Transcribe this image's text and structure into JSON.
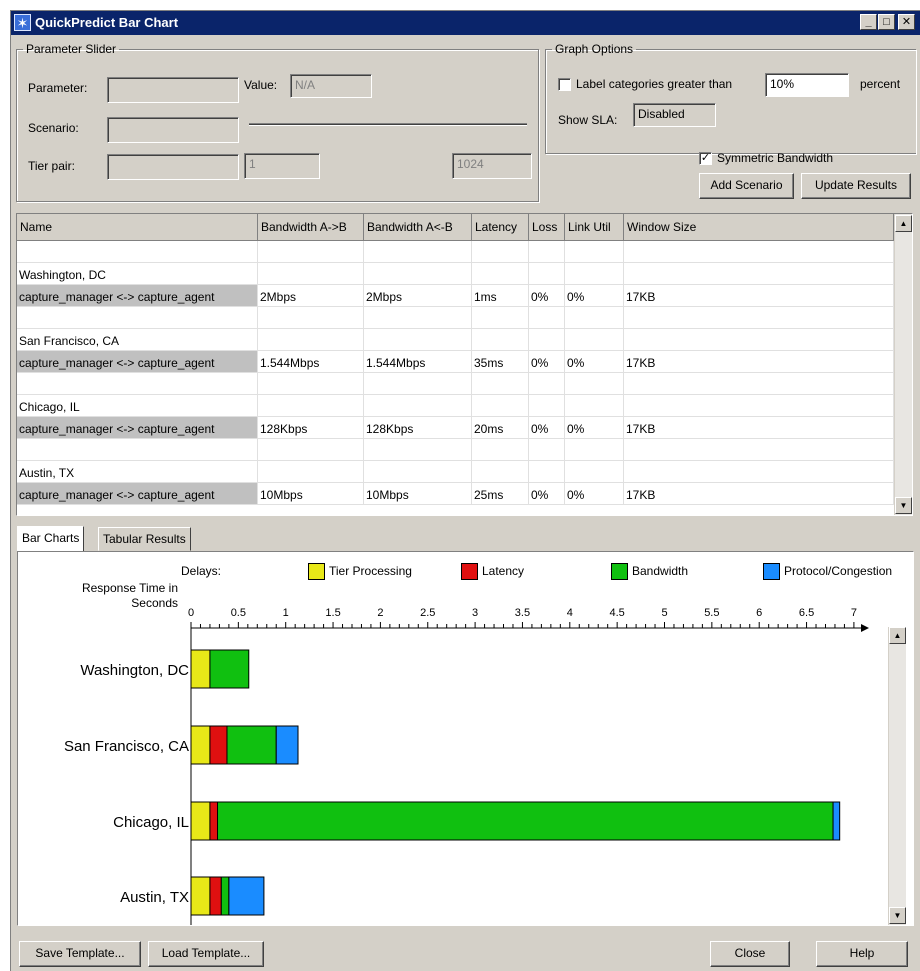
{
  "window": {
    "title": "QuickPredict Bar Chart"
  },
  "parameter_slider": {
    "legend": "Parameter Slider",
    "parameter_label": "Parameter:",
    "value_label": "Value:",
    "value": "N/A",
    "scenario_label": "Scenario:",
    "tier_pair_label": "Tier pair:",
    "min": "1",
    "max": "1024"
  },
  "graph_options": {
    "legend": "Graph Options",
    "label_categories_label": "Label categories greater than",
    "label_categories_value": "10%",
    "percent_label": "percent",
    "show_sla_label": "Show SLA:",
    "show_sla_value": "Disabled",
    "symmetric_bandwidth_label": "Symmetric Bandwidth",
    "symmetric_checked": true,
    "add_scenario": "Add Scenario",
    "update_results": "Update Results"
  },
  "table": {
    "columns": [
      "Name",
      "Bandwidth A->B",
      "Bandwidth A<-B",
      "Latency",
      "Loss",
      "Link Util",
      "Window Size"
    ],
    "groups": [
      {
        "location": "Washington, DC",
        "link": "capture_manager <-> capture_agent",
        "bw_ab": "2Mbps",
        "bw_ba": "2Mbps",
        "latency": "1ms",
        "loss": "0%",
        "util": "0%",
        "window": "17KB"
      },
      {
        "location": "San Francisco, CA",
        "link": "capture_manager <-> capture_agent",
        "bw_ab": "1.544Mbps",
        "bw_ba": "1.544Mbps",
        "latency": "35ms",
        "loss": "0%",
        "util": "0%",
        "window": "17KB"
      },
      {
        "location": "Chicago, IL",
        "link": "capture_manager <-> capture_agent",
        "bw_ab": "128Kbps",
        "bw_ba": "128Kbps",
        "latency": "20ms",
        "loss": "0%",
        "util": "0%",
        "window": "17KB"
      },
      {
        "location": "Austin, TX",
        "link": "capture_manager <-> capture_agent",
        "bw_ab": "10Mbps",
        "bw_ba": "10Mbps",
        "latency": "25ms",
        "loss": "0%",
        "util": "0%",
        "window": "17KB"
      }
    ]
  },
  "tabs": [
    "Bar Charts",
    "Tabular Results"
  ],
  "chart_data": {
    "type": "bar",
    "orientation": "horizontal",
    "stacked": true,
    "legend_title": "Delays:",
    "axis_label": "Response Time in Seconds",
    "xlim": [
      0,
      7
    ],
    "ticks": [
      "0",
      "0.5",
      "1",
      "1.5",
      "2",
      "2.5",
      "3",
      "3.5",
      "4",
      "4.5",
      "5",
      "5.5",
      "6",
      "6.5",
      "7"
    ],
    "categories": [
      "Washington, DC",
      "San Francisco, CA",
      "Chicago, IL",
      "Austin, TX"
    ],
    "series": [
      {
        "name": "Tier Processing",
        "color": "#e8e818",
        "values": [
          0.2,
          0.2,
          0.2,
          0.2
        ]
      },
      {
        "name": "Latency",
        "color": "#e01010",
        "values": [
          0.0,
          0.18,
          0.08,
          0.12
        ]
      },
      {
        "name": "Bandwidth",
        "color": "#10c010",
        "values": [
          0.41,
          0.52,
          6.5,
          0.08
        ]
      },
      {
        "name": "Protocol/Congestion",
        "color": "#1a8cff",
        "values": [
          0.0,
          0.23,
          0.07,
          0.37
        ]
      }
    ]
  },
  "footer": {
    "save_template": "Save Template...",
    "load_template": "Load Template...",
    "close": "Close",
    "help": "Help"
  }
}
